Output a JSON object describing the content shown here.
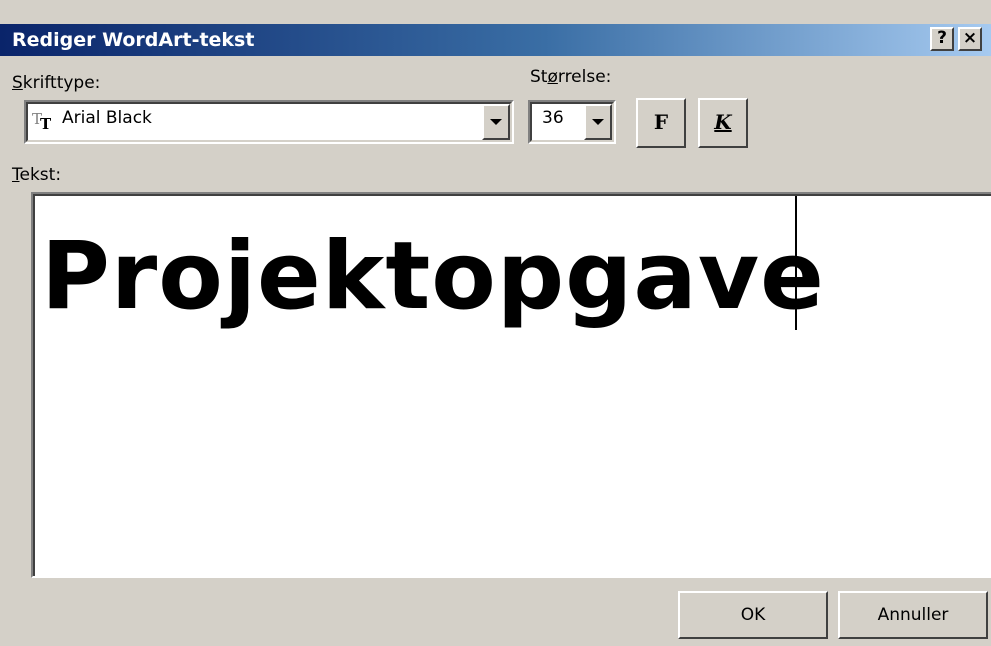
{
  "window": {
    "title": "Rediger WordArt-tekst",
    "help_button": "?",
    "close_button": "×"
  },
  "font": {
    "label_accel": "S",
    "label_rest": "krifttype:",
    "value": "Arial Black",
    "icon": "truetype-font-icon"
  },
  "size": {
    "label_pre": "St",
    "label_accel": "ø",
    "label_rest": "rrelse:",
    "value": "36"
  },
  "format": {
    "bold_label": "F",
    "italic_label": "K"
  },
  "text": {
    "label_accel": "T",
    "label_rest": "ekst:",
    "value": "Projektopgave"
  },
  "buttons": {
    "ok": "OK",
    "cancel": "Annuller"
  }
}
